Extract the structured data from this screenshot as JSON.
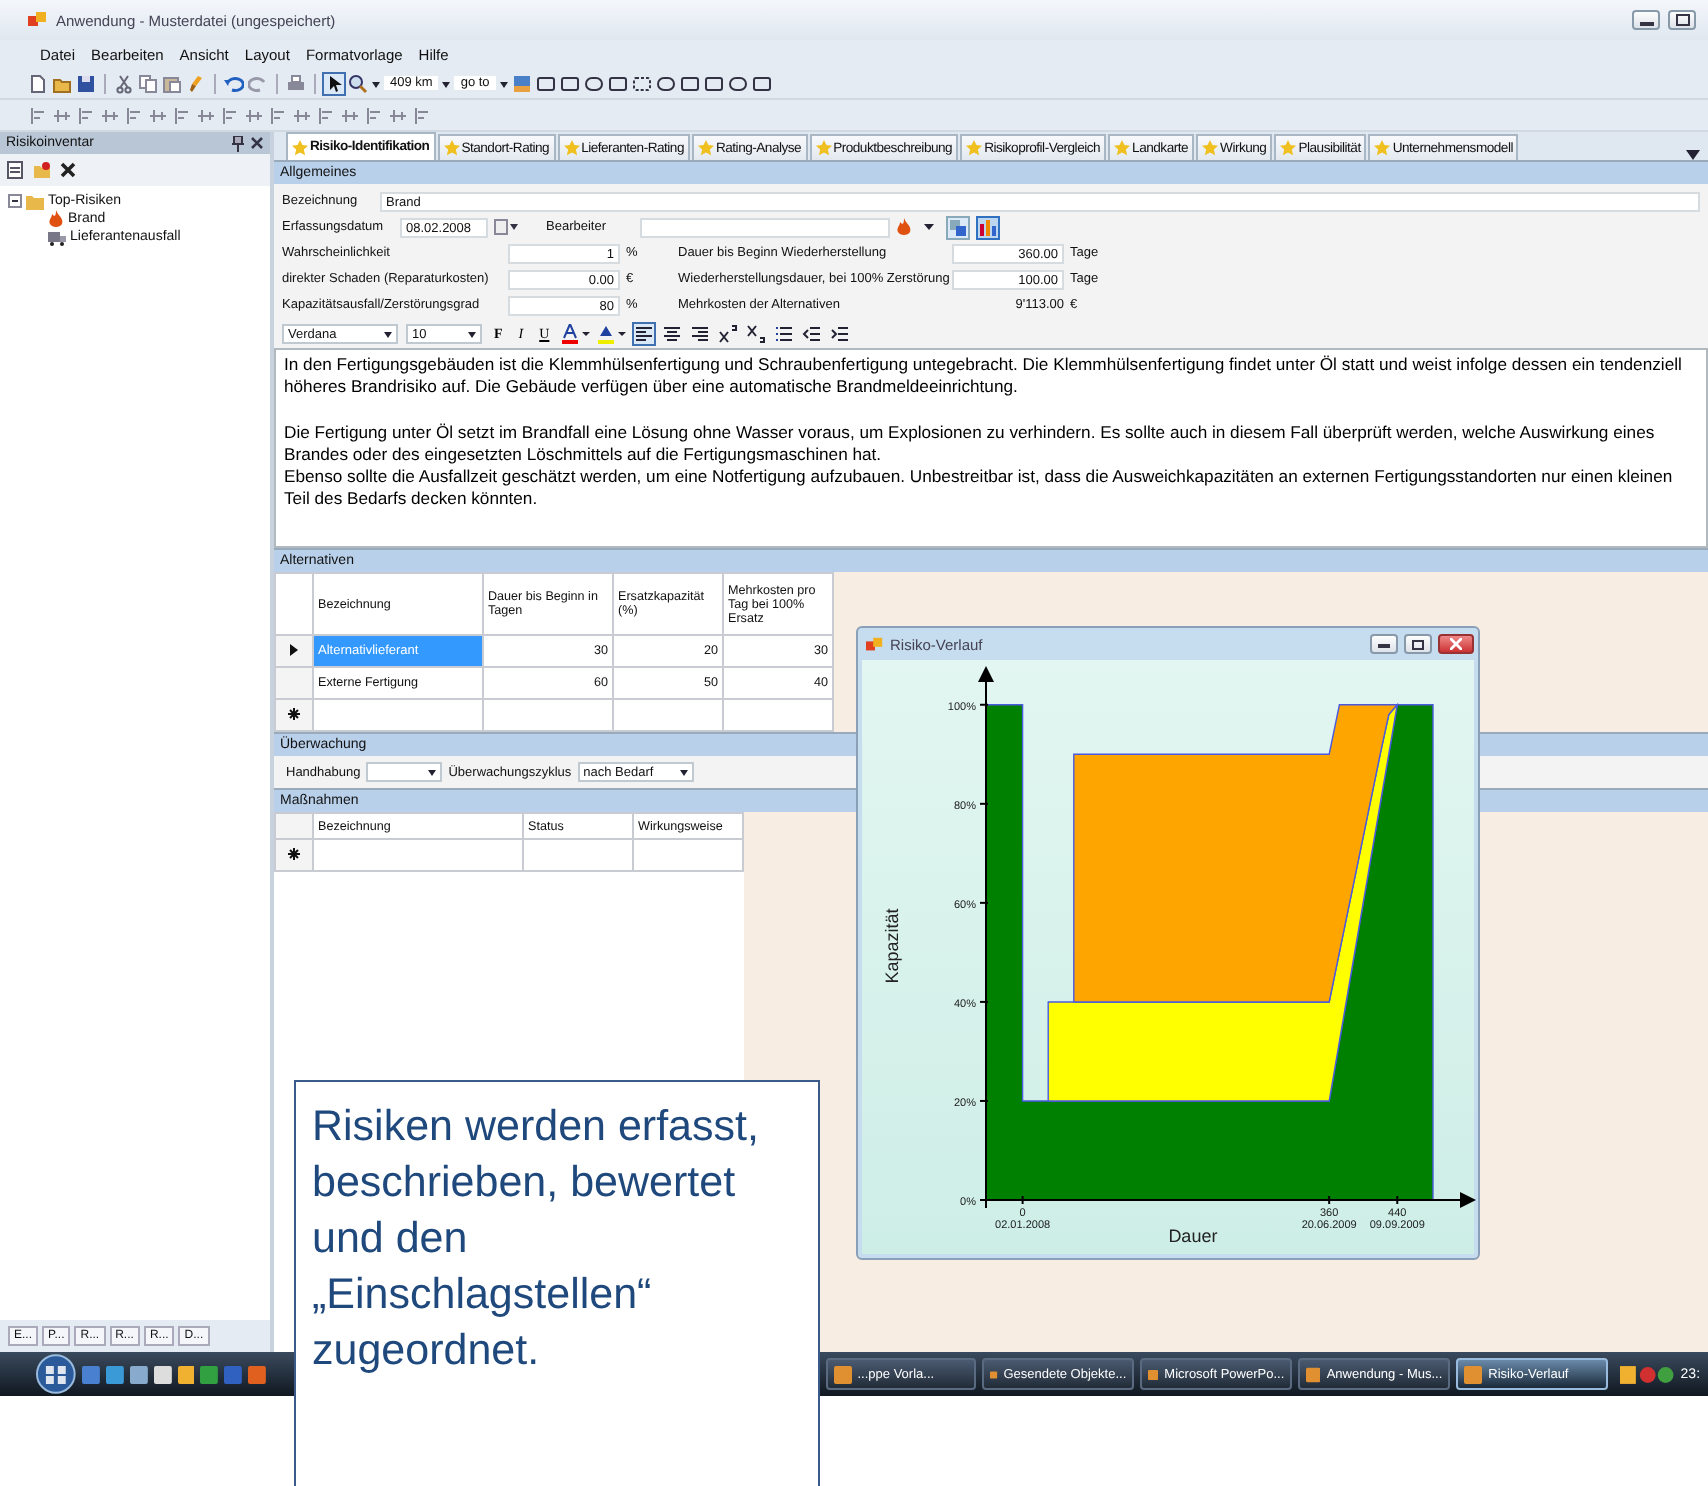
{
  "window": {
    "title": "Anwendung - Musterdatei (ungespeichert)"
  },
  "menu": [
    "Datei",
    "Bearbeiten",
    "Ansicht",
    "Layout",
    "Formatvorlage",
    "Hilfe"
  ],
  "toolbar": {
    "distance": "409 km",
    "goto": "go to"
  },
  "sidebar": {
    "title": "Risikoinventar",
    "tree": [
      {
        "label": "Top-Risiken",
        "expanded": true,
        "children": [
          {
            "label": "Brand"
          },
          {
            "label": "Lieferantenausfall"
          }
        ]
      }
    ],
    "tabs": [
      "E...",
      "P...",
      "R...",
      "R...",
      "R...",
      "D..."
    ]
  },
  "tabs": [
    {
      "label": "Risiko-Identifikation",
      "selected": true
    },
    {
      "label": "Standort-Rating",
      "selected": false
    },
    {
      "label": "Lieferanten-Rating",
      "selected": false
    },
    {
      "label": "Rating-Analyse",
      "selected": false
    },
    {
      "label": "Produktbeschreibung",
      "selected": false
    },
    {
      "label": "Risikoprofil-Vergleich",
      "selected": false
    },
    {
      "label": "Landkarte",
      "selected": false
    },
    {
      "label": "Wirkung",
      "selected": false
    },
    {
      "label": "Plausibilität",
      "selected": false
    },
    {
      "label": "Unternehmensmodell",
      "selected": false
    }
  ],
  "general": {
    "header": "Allgemeines",
    "name_label": "Bezeichnung",
    "name": "Brand",
    "date_label": "Erfassungsdatum",
    "date": "08.02.2008",
    "editor_label": "Bearbeiter",
    "left": [
      {
        "label": "Wahrscheinlichkeit",
        "value": "1",
        "unit": "%"
      },
      {
        "label": "direkter Schaden (Reparaturkosten)",
        "value": "0.00",
        "unit": "€"
      },
      {
        "label": "Kapazitätsausfall/Zerstörungsgrad",
        "value": "80",
        "unit": "%"
      }
    ],
    "right": [
      {
        "kind": "field",
        "label": "Dauer bis Beginn Wiederherstellung",
        "value": "360.00",
        "unit": "Tage"
      },
      {
        "kind": "field",
        "label": "Wiederherstellungsdauer, bei 100% Zerstörung",
        "value": "100.00",
        "unit": "Tage"
      },
      {
        "kind": "readout",
        "label": "Mehrkosten der Alternativen",
        "value": "9'113.00",
        "unit": "€"
      }
    ]
  },
  "editor": {
    "font": "Verdana",
    "size": "10",
    "bold": "F",
    "italic": "I",
    "underline": "U",
    "paragraphs": [
      {
        "text": "In den Fertigungsgebäuden ist die Klemmhülsenfertigung und Schraubenfertigung untegebracht. Die Klemmhülsenfertigung findet unter Öl statt und weist infolge dessen ein tendenziell höheres Brandrisiko auf. Die Gebäude verfügen über eine automatische Brandmeldeeinrichtung.",
        "blank_after": true
      },
      {
        "text": "Die Fertigung unter Öl setzt im Brandfall eine Lösung ohne Wasser voraus, um Explosionen zu verhindern. Es sollte auch in diesem Fall überprüft werden, welche Auswirkung eines Brandes oder des eingesetzten Löschmittels auf die Fertigungsmaschinen hat.",
        "blank_after": false
      },
      {
        "text": "Ebenso sollte die Ausfallzeit geschätzt werden, um eine Notfertigung aufzubauen. Unbestreitbar ist, dass die Ausweichkapazitäten an externen Fertigungsstandorten nur einen kleinen Teil des Bedarfs decken könnten.",
        "blank_after": false
      }
    ]
  },
  "alternatives": {
    "header": "Alternativen",
    "columns": [
      "Bezeichnung",
      "Dauer bis Beginn in Tagen",
      "Ersatzkapazität (%)",
      "Mehrkosten pro Tag bei 100% Ersatz"
    ],
    "rows": [
      {
        "cells": [
          "Alternativlieferant",
          "30",
          "20",
          "30"
        ],
        "selected": true
      },
      {
        "cells": [
          "Externe Fertigung",
          "60",
          "50",
          "40"
        ],
        "selected": false
      }
    ]
  },
  "monitoring": {
    "header": "Überwachung",
    "handling_label": "Handhabung",
    "cycle_label": "Überwachungszyklus",
    "cycle": "nach Bedarf"
  },
  "measures": {
    "header": "Maßnahmen",
    "columns": [
      "Bezeichnung",
      "Status",
      "Wirkungsweise"
    ]
  },
  "chart_window": {
    "title": "Risiko-Verlauf",
    "chart_data": {
      "type": "area",
      "stacked": true,
      "xlabel": "Dauer",
      "ylabel": "Kapazität",
      "x": [
        -43,
        0,
        0,
        30,
        30,
        60,
        60,
        360,
        372,
        420,
        430,
        440,
        482
      ],
      "series": [
        {
          "color": "#008000",
          "values": [
            100,
            100,
            20,
            20,
            20,
            20,
            20,
            20,
            32,
            80,
            90,
            100,
            100
          ]
        },
        {
          "color": "#ffff00",
          "values": [
            null,
            null,
            null,
            0,
            20,
            20,
            20,
            20,
            18,
            10,
            8,
            0,
            null
          ]
        },
        {
          "color": "#ffa500",
          "values": [
            null,
            null,
            null,
            null,
            null,
            0,
            50,
            50,
            50,
            10,
            2,
            0,
            null
          ]
        }
      ],
      "xlim": [
        -43,
        516
      ],
      "ylim": [
        0,
        105
      ],
      "xticks": [
        0,
        360,
        440
      ],
      "annotations": [
        "02.01.2008",
        "20.06.2009",
        "09.09.2009"
      ],
      "yticks": [
        {
          "value": 0,
          "label": "0%"
        },
        {
          "value": 20,
          "label": "20%"
        },
        {
          "value": 40,
          "label": "40%"
        },
        {
          "value": 60,
          "label": "60%"
        },
        {
          "value": 80,
          "label": "80%"
        },
        {
          "value": 100,
          "label": "100%"
        }
      ]
    }
  },
  "taskbar": {
    "items": [
      {
        "label": "...ppe Vorla...",
        "selected": false
      },
      {
        "label": "Gesendete Objekte...",
        "selected": false
      },
      {
        "label": "Microsoft PowerPo...",
        "selected": false
      },
      {
        "label": "Anwendung - Mus...",
        "selected": false
      },
      {
        "label": "Risiko-Verlauf",
        "selected": true
      }
    ],
    "clock": "23:"
  },
  "callout": {
    "text": "Risiken werden erfasst,\nbeschrieben, bewertet\nund den\n„Einschlagstellen“\nzugeordnet."
  }
}
